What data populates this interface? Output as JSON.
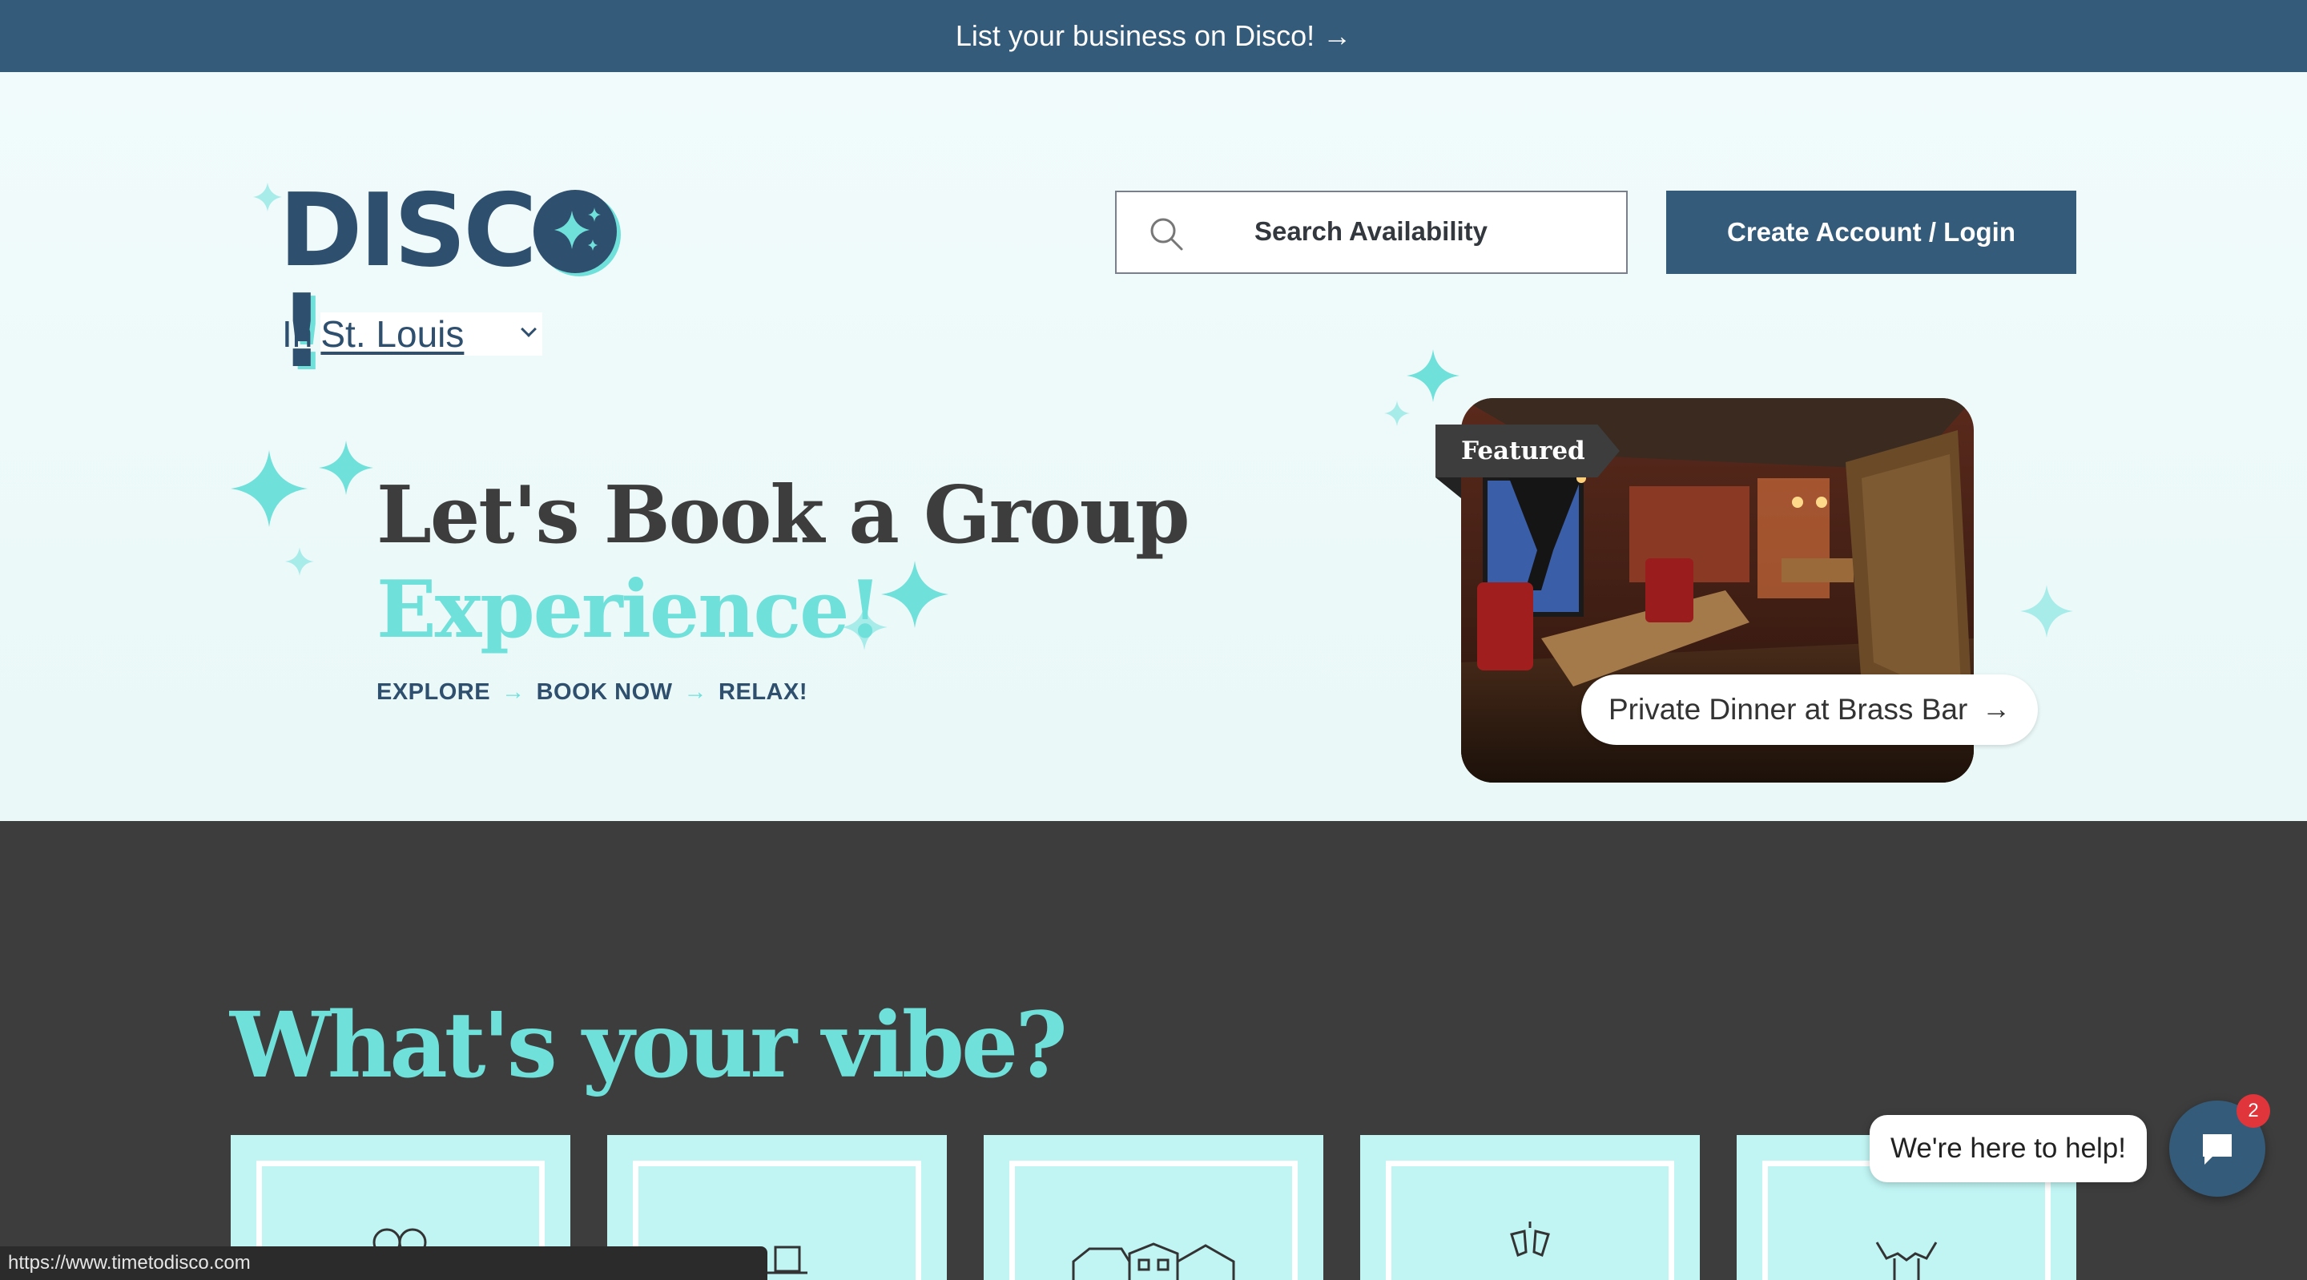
{
  "promo_banner": {
    "text": "List your business on Disco! →"
  },
  "header": {
    "logo_text": "DISC",
    "logo_bang": "!",
    "city_prefix": "In",
    "city": "St. Louis",
    "search_label": "Search Availability",
    "login_label": "Create Account / Login"
  },
  "hero": {
    "headline_line1": "Let's Book a Group",
    "headline_line2": "Experience!",
    "steps": [
      "EXPLORE",
      "BOOK NOW",
      "RELAX!"
    ],
    "step_arrow": "→"
  },
  "featured": {
    "tag": "Featured",
    "listing_title": "Private Dinner at Brass Bar",
    "listing_arrow": "→"
  },
  "vibe": {
    "title": "What's your vibe?",
    "tiles": [
      {
        "icon": "people-icon"
      },
      {
        "icon": "desk-icon"
      },
      {
        "icon": "houses-icon"
      },
      {
        "icon": "cheers-icon"
      },
      {
        "icon": "celebrate-icon"
      }
    ]
  },
  "status_bar": {
    "url": "https://www.timetodisco.com"
  },
  "chat": {
    "bubble": "We're here to help!",
    "badge": "2"
  },
  "colors": {
    "navy": "#345b79",
    "teal": "#6fe0da",
    "dark": "#3d3d3d",
    "tile": "#c0f5f4"
  }
}
